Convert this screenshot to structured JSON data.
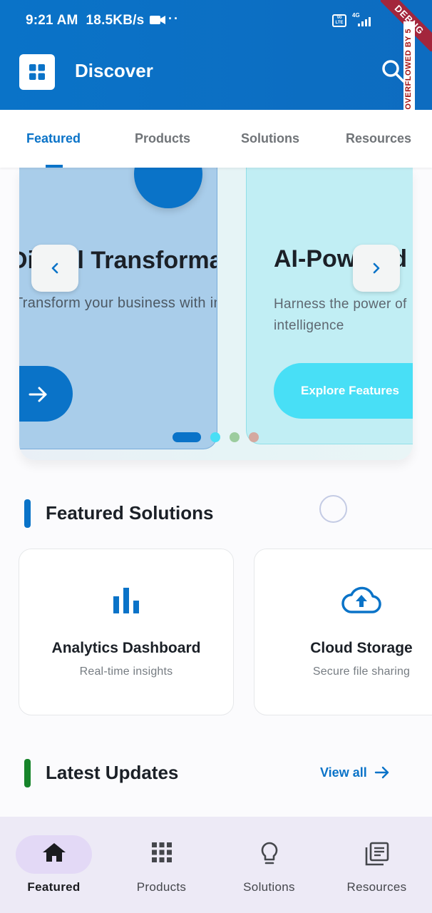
{
  "status_bar": {
    "time": "9:21 AM",
    "speed": "18.5KB/s",
    "dots": "··",
    "volte": "Vo LTE",
    "network": "4G"
  },
  "header": {
    "title": "Discover",
    "debug_banner": "DEBUG",
    "overflow_text": "OVERFLOWED BY 5"
  },
  "tabs": [
    {
      "label": "Featured",
      "active": true
    },
    {
      "label": "Products",
      "active": false
    },
    {
      "label": "Solutions",
      "active": false
    },
    {
      "label": "Resources",
      "active": false
    }
  ],
  "carousel": {
    "slides": [
      {
        "title": "Digital Transformation",
        "description": "Transform your business with innovative",
        "color": "#0a73c8"
      },
      {
        "title": "AI-Powered Solutions",
        "description_line1": "Harness the power of",
        "description_line2": "intelligence",
        "button": "Explore Features",
        "color": "#48dff6"
      }
    ],
    "active_index": 0,
    "dot_colors": [
      "#0a73c8",
      "#48dff6",
      "#9ccc9e",
      "#d4a9a0"
    ]
  },
  "featured_solutions": {
    "title": "Featured Solutions",
    "accent": "#0a73c8",
    "cards": [
      {
        "icon": "bar-chart-icon",
        "title": "Analytics Dashboard",
        "subtitle": "Real-time insights"
      },
      {
        "icon": "cloud-upload-icon",
        "title": "Cloud Storage",
        "subtitle": "Secure file sharing"
      }
    ]
  },
  "latest_updates": {
    "title": "Latest Updates",
    "accent": "#16842a",
    "view_all": "View all"
  },
  "bottom_nav": [
    {
      "label": "Featured",
      "icon": "home-icon",
      "active": true
    },
    {
      "label": "Products",
      "icon": "apps-grid-icon",
      "active": false
    },
    {
      "label": "Solutions",
      "icon": "lightbulb-icon",
      "active": false
    },
    {
      "label": "Resources",
      "icon": "library-books-icon",
      "active": false
    }
  ]
}
